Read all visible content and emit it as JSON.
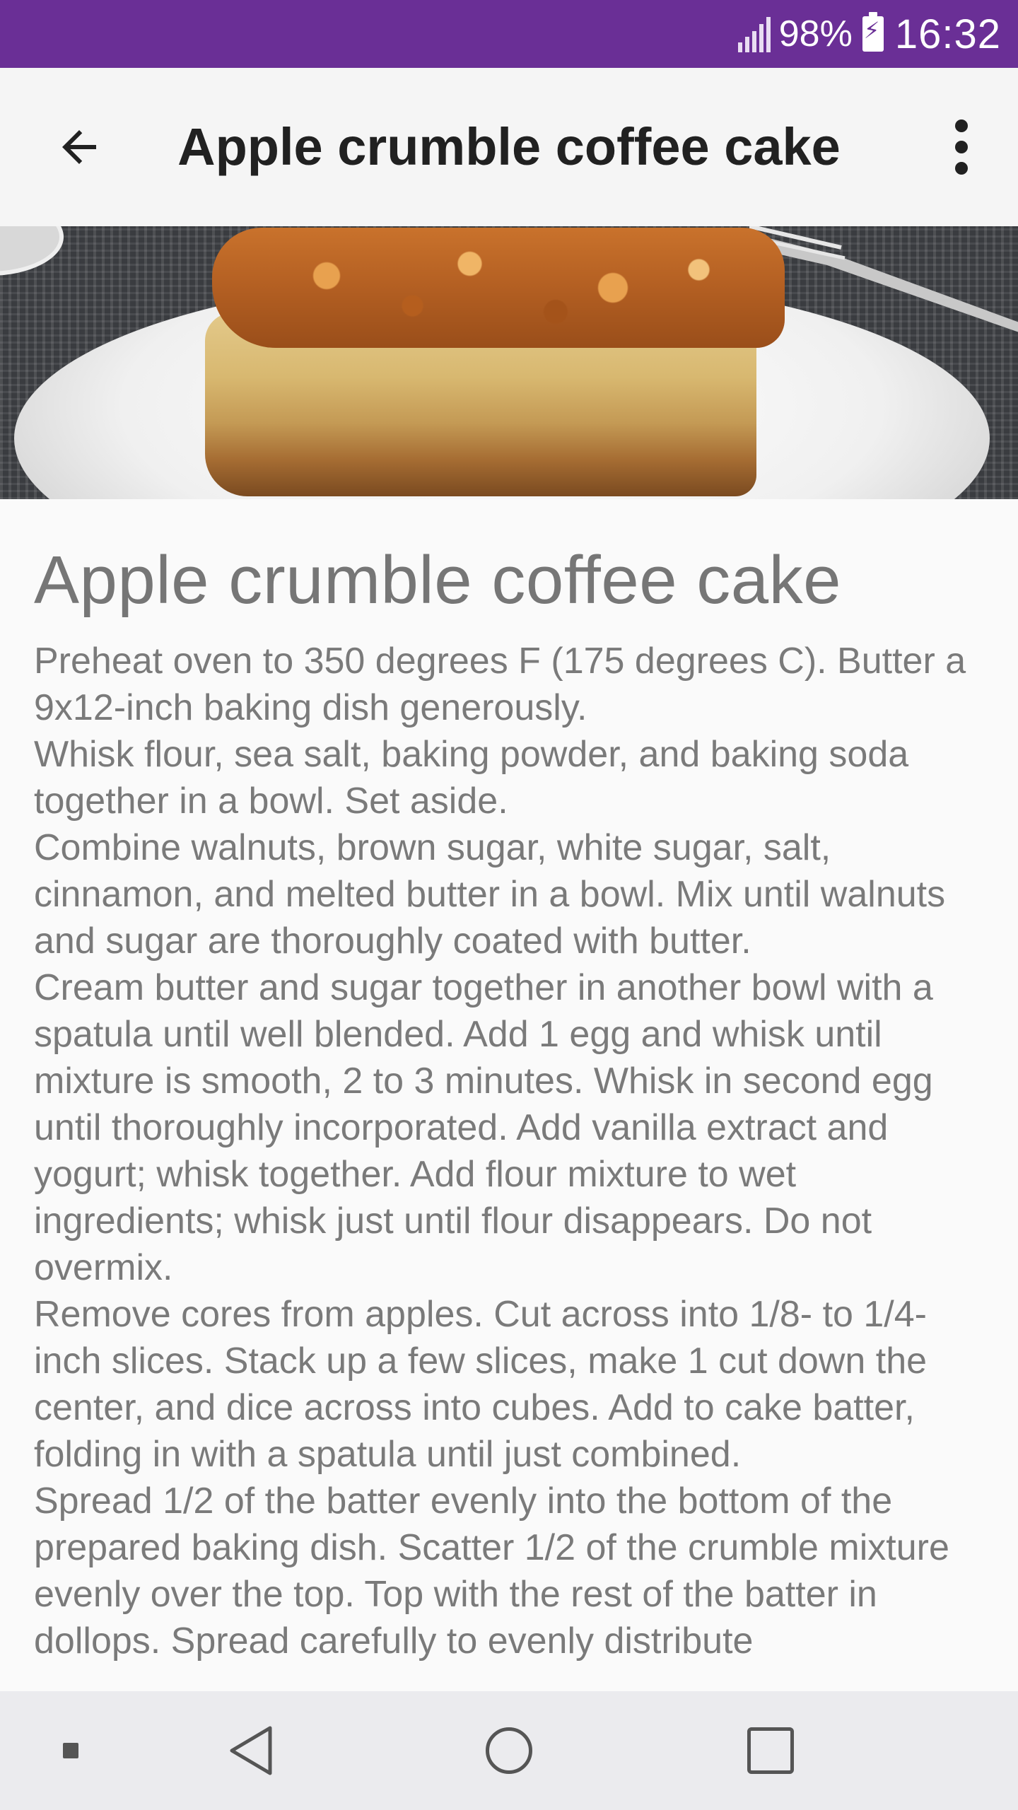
{
  "status_bar": {
    "battery_percent": "98%",
    "time": "16:32",
    "icons": [
      "signal-icon",
      "battery-charging-icon"
    ]
  },
  "app_bar": {
    "title": "Apple crumble coffee cake",
    "icons": [
      "arrow-back-icon",
      "more-vert-icon"
    ]
  },
  "hero_image": {
    "subject": "photo-of-coffee-cake",
    "icon": "recipe-photo"
  },
  "content": {
    "heading": "Apple crumble coffee cake",
    "body": "Preheat oven to 350 degrees F (175 degrees C). Butter a 9x12-inch baking dish generously.\nWhisk flour, sea salt, baking powder, and baking soda together in a bowl. Set aside.\nCombine walnuts, brown sugar, white sugar, salt, cinnamon, and melted butter in a bowl. Mix until walnuts and sugar are thoroughly coated with butter.\nCream butter and sugar together in another bowl with a spatula until well blended. Add 1 egg and whisk until mixture is smooth, 2 to 3 minutes. Whisk in second egg until thoroughly incorporated. Add vanilla extract and yogurt; whisk together. Add flour mixture to wet ingredients; whisk just until flour disappears. Do not overmix.\nRemove cores from apples. Cut across into 1/8- to 1/4-inch slices. Stack up a few slices, make 1 cut down the center, and dice across into cubes. Add to cake batter, folding in with a spatula until just combined.\nSpread 1/2 of the batter evenly into the bottom of the prepared baking dish. Scatter 1/2 of the crumble mixture evenly over the top. Top with the rest of the batter in dollops. Spread carefully to evenly distribute"
  },
  "nav_bar": {
    "icons": [
      "overflow-dot-icon",
      "back-triangle-icon",
      "home-circle-icon",
      "recents-square-icon"
    ]
  },
  "colors": {
    "status_bar": "#6a2f96",
    "app_bar": "#f5f5f5",
    "content_text": "#7a7a7a",
    "nav_bar": "#ebebee"
  }
}
